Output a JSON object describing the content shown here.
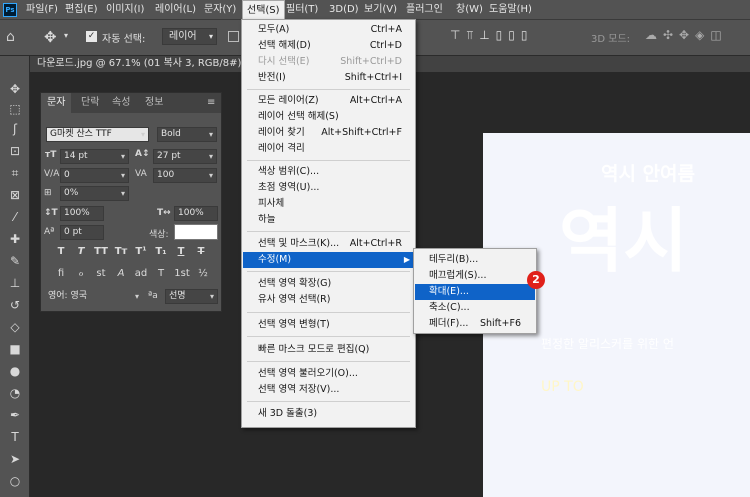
{
  "menubar": {
    "logo": "Ps",
    "items": [
      "파일(F)",
      "편집(E)",
      "이미지(I)",
      "레이어(L)",
      "문자(Y)",
      "선택(S)",
      "필터(T)",
      "3D(D)",
      "보기(V)",
      "플러그인",
      "창(W)",
      "도움말(H)"
    ]
  },
  "options": {
    "auto_select_label": "자동 선택:",
    "auto_select_value": "레이어",
    "mode_3d_label": "3D 모드:"
  },
  "document_tab": {
    "title": "다운로드.jpg @ 67.1% (01 복사 3, RGB/8#) *"
  },
  "character_panel": {
    "tabs": [
      "문자",
      "단락",
      "속성",
      "정보"
    ],
    "font_family": "G마켓 산스 TTF",
    "font_style": "Bold",
    "font_size": "14 pt",
    "leading": "27 pt",
    "kerning": "0",
    "tracking": "100",
    "tsume": "0%",
    "vertical_scale": "100%",
    "horizontal_scale": "100%",
    "baseline_shift": "0 pt",
    "color_label": "색상:",
    "type_buttons": [
      "T",
      "T",
      "TT",
      "Tт",
      "T¹",
      "T₁",
      "T",
      "T"
    ],
    "ot_buttons": [
      "fi",
      "ℴ",
      "st",
      "A",
      "ad",
      "T",
      "1st",
      "½"
    ],
    "language": "영어: 영국",
    "aa_label": "ªa",
    "anti_alias": "선명"
  },
  "select_menu": {
    "items": [
      {
        "label": "모두(A)",
        "shortcut": "Ctrl+A"
      },
      {
        "label": "선택 해제(D)",
        "shortcut": "Ctrl+D"
      },
      {
        "label": "다시 선택(E)",
        "shortcut": "Shift+Ctrl+D",
        "disabled": true
      },
      {
        "label": "반전(I)",
        "shortcut": "Shift+Ctrl+I"
      },
      {
        "label": "모든 레이어(Z)",
        "shortcut": "Alt+Ctrl+A"
      },
      {
        "label": "레이어 선택 해제(S)",
        "shortcut": ""
      },
      {
        "label": "레이어 찾기",
        "shortcut": "Alt+Shift+Ctrl+F"
      },
      {
        "label": "레이어 격리",
        "shortcut": ""
      },
      {
        "label": "색상 범위(C)...",
        "shortcut": ""
      },
      {
        "label": "초점 영역(U)...",
        "shortcut": ""
      },
      {
        "label": "피사체",
        "shortcut": ""
      },
      {
        "label": "하늘",
        "shortcut": ""
      },
      {
        "label": "선택 및 마스크(K)...",
        "shortcut": "Alt+Ctrl+R"
      },
      {
        "label": "수정(M)",
        "shortcut": "",
        "highlighted": true
      },
      {
        "label": "선택 영역 확장(G)",
        "shortcut": ""
      },
      {
        "label": "유사 영역 선택(R)",
        "shortcut": ""
      },
      {
        "label": "선택 영역 변형(T)",
        "shortcut": ""
      },
      {
        "label": "빠른 마스크 모드로 편집(Q)",
        "shortcut": ""
      },
      {
        "label": "선택 영역 불러오기(O)...",
        "shortcut": ""
      },
      {
        "label": "선택 영역 저장(V)...",
        "shortcut": ""
      },
      {
        "label": "새 3D 돌출(3)",
        "shortcut": ""
      }
    ]
  },
  "modify_submenu": {
    "items": [
      {
        "label": "테두리(B)...",
        "shortcut": ""
      },
      {
        "label": "매끄럽게(S)...",
        "shortcut": ""
      },
      {
        "label": "확대(E)...",
        "shortcut": "",
        "highlighted": true
      },
      {
        "label": "축소(C)...",
        "shortcut": ""
      },
      {
        "label": "페더(F)...",
        "shortcut": "Shift+F6"
      }
    ]
  },
  "callout": {
    "number": "2",
    "color": "#e0201a"
  },
  "canvas_text": {
    "line1": "역시 안여름",
    "big": "역시",
    "sub": "편정한 알리스커를 위한 언",
    "upto": "UP TO"
  },
  "colors": {
    "accent": "#0f63c8",
    "chrome": "#535353",
    "workspace": "#282828"
  }
}
